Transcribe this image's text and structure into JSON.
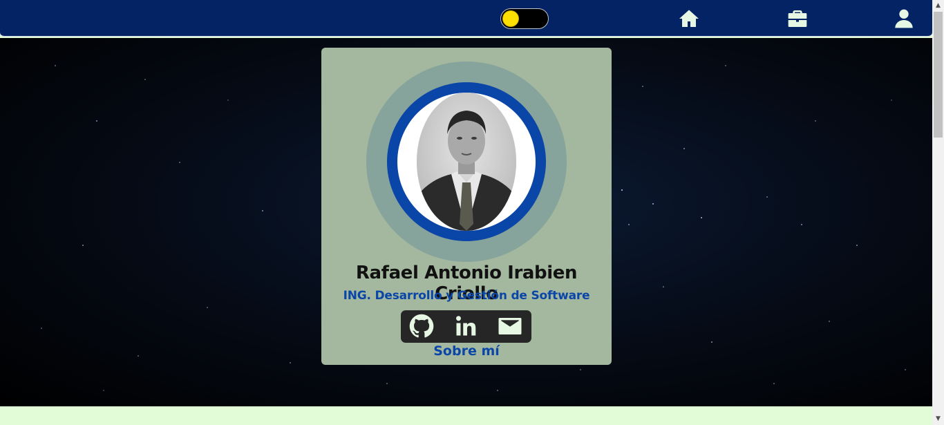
{
  "theme": {
    "navbar_bg": "#032365",
    "card_bg": "#a3b89e",
    "accent_blue": "#0a45a8",
    "icon_color": "#e6f7e3",
    "toggle_knob": "#ffe000"
  },
  "navbar": {
    "theme_toggle": {
      "state": "off",
      "knob_color": "#ffe000"
    },
    "icons": [
      "home-icon",
      "briefcase-icon",
      "user-icon"
    ]
  },
  "profile": {
    "name": "Rafael Antonio Irabien Criollo",
    "title": "ING. Desarrollo y Gestión de Software",
    "about_link": "Sobre mí",
    "socials": [
      "github-icon",
      "linkedin-icon",
      "mail-icon"
    ]
  }
}
